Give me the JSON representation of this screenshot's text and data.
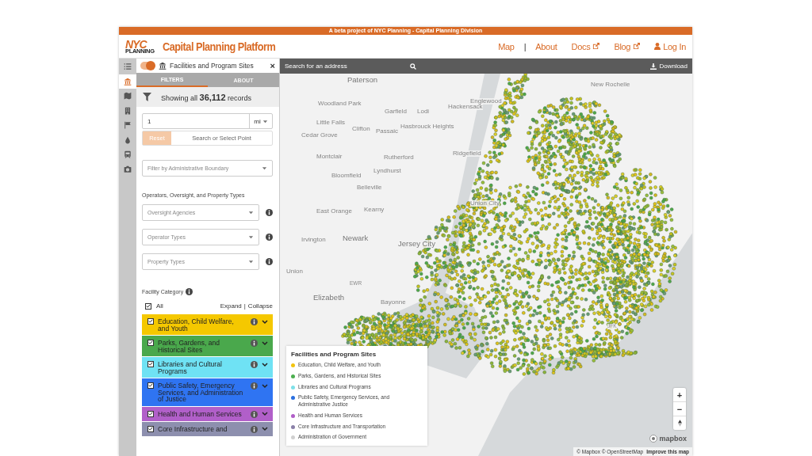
{
  "banner": "A beta project of NYC Planning - Capital Planning Division",
  "logo": {
    "top": "NYC",
    "bottom": "PLANNING"
  },
  "title": "Capital Planning Platform",
  "nav": [
    {
      "label": "Map",
      "kind": "plain"
    },
    {
      "label": "|",
      "kind": "separator"
    },
    {
      "label": "About",
      "kind": "plain"
    },
    {
      "label": "Docs",
      "kind": "external"
    },
    {
      "label": "Blog",
      "kind": "external"
    },
    {
      "label": "Log In",
      "kind": "user"
    }
  ],
  "rail": [
    {
      "kind": "list",
      "selected": false
    },
    {
      "kind": "bank",
      "selected": true
    },
    {
      "kind": "map",
      "selected": false
    },
    {
      "kind": "building",
      "selected": false
    },
    {
      "kind": "flag",
      "selected": false
    },
    {
      "kind": "drop",
      "selected": false
    },
    {
      "kind": "train",
      "selected": false
    },
    {
      "kind": "camera",
      "selected": false
    }
  ],
  "panel": {
    "layer_on": true,
    "title": "Facilities and Program Sites",
    "close": "×",
    "tabs": [
      {
        "label": "FILTERS",
        "selected": true
      },
      {
        "label": "ABOUT",
        "selected": false
      }
    ],
    "summary": "Showing all **36,112** records",
    "distance": {
      "value": "1",
      "unit": "mi"
    },
    "reset": {
      "label": "Reset",
      "disabled": true
    },
    "point_button": "Search or Select Point",
    "boundary_placeholder": "Filter by Administrative Boundary",
    "types_heading": "Operators, Oversight, and Property Types",
    "type_filters": [
      {
        "placeholder": "Oversight Agencies"
      },
      {
        "placeholder": "Operator Types"
      },
      {
        "placeholder": "Property Types"
      }
    ],
    "category_heading": "Facility Category",
    "all": {
      "label": "All",
      "checked": true
    },
    "expand": "Expand",
    "divider": "|",
    "collapse": "Collapse",
    "categories": [
      {
        "label": "Education, Child Welfare, and Youth",
        "checked": true,
        "color": "#f5c800"
      },
      {
        "label": "Parks, Gardens, and Historical Sites",
        "checked": true,
        "color": "#4aa84c"
      },
      {
        "label": "Libraries and Cultural Programs",
        "checked": true,
        "color": "#6fe2f4"
      },
      {
        "label": "Public Safety, Emergency Services, and Administration of Justice",
        "checked": true,
        "color": "#2f74f2"
      },
      {
        "label": "Health and Human Services",
        "checked": true,
        "color": "#b15fc9"
      },
      {
        "label": "Core Infrastructure and",
        "checked": true,
        "color": "#8d8fae"
      }
    ]
  },
  "map": {
    "search_placeholder": "Search for an address",
    "download": "Download",
    "labels": [
      {
        "text": "Paterson",
        "kind": "city"
      },
      {
        "text": "Woodland Park",
        "kind": "town"
      },
      {
        "text": "Garfield",
        "kind": "town"
      },
      {
        "text": "Lodi",
        "kind": "town"
      },
      {
        "text": "Hackensack",
        "kind": "town"
      },
      {
        "text": "Englewood",
        "kind": "town"
      },
      {
        "text": "New Rochelle",
        "kind": "town"
      },
      {
        "text": "Little Falls",
        "kind": "town"
      },
      {
        "text": "Clifton",
        "kind": "town"
      },
      {
        "text": "Passaic",
        "kind": "town"
      },
      {
        "text": "Hasbrouck Heights",
        "kind": "town"
      },
      {
        "text": "Cedar Grove",
        "kind": "town"
      },
      {
        "text": "Montclair",
        "kind": "town"
      },
      {
        "text": "Rutherford",
        "kind": "town"
      },
      {
        "text": "Ridgefield",
        "kind": "town"
      },
      {
        "text": "Lyndhurst",
        "kind": "town"
      },
      {
        "text": "Bloomfield",
        "kind": "town"
      },
      {
        "text": "Belleville",
        "kind": "town"
      },
      {
        "text": "Union City",
        "kind": "town"
      },
      {
        "text": "East Orange",
        "kind": "town"
      },
      {
        "text": "Kearny",
        "kind": "town"
      },
      {
        "text": "Irvington",
        "kind": "town"
      },
      {
        "text": "Newark",
        "kind": "city"
      },
      {
        "text": "Jersey City",
        "kind": "city"
      },
      {
        "text": "Union",
        "kind": "town"
      },
      {
        "text": "EWR",
        "kind": "airport"
      },
      {
        "text": "Elizabeth",
        "kind": "city"
      },
      {
        "text": "Bayonne",
        "kind": "town"
      },
      {
        "text": "JFK",
        "kind": "airport"
      }
    ],
    "legend": {
      "title": "Facilities and Program Sites",
      "items": [
        {
          "label": "Education, Child Welfare, and Youth",
          "color": "#f2c40f"
        },
        {
          "label": "Parks, Gardens, and Historical Sites",
          "color": "#4caf50"
        },
        {
          "label": "Libraries and Cultural Programs",
          "color": "#7ee0e8"
        },
        {
          "label": "Public Safety, Emergency Services, and Administrative Justice",
          "color": "#2b6fe0"
        },
        {
          "label": "Health and Human Services",
          "color": "#b05ec8"
        },
        {
          "label": "Core Infrastructure and Transportation",
          "color": "#8a80a8"
        },
        {
          "label": "Administration of Government",
          "color": "#d0d0d0"
        }
      ]
    },
    "zoom_in": "+",
    "zoom_out": "−",
    "mapbox": "mapbox",
    "attribution": "© Mapbox © OpenStreetMap",
    "improve": "Improve this map"
  }
}
